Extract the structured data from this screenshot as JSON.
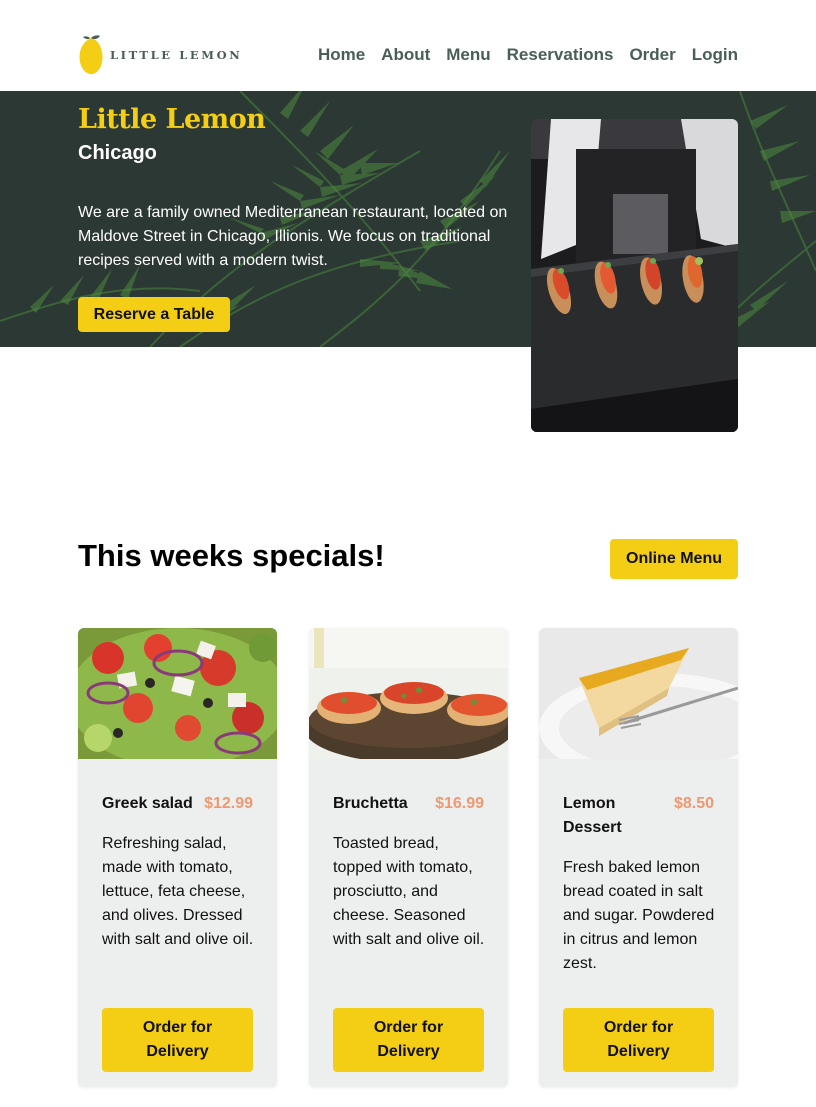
{
  "brand": {
    "logo_text": "LITTLE LEMON",
    "logo_icon": "lemon-icon",
    "colors": {
      "primary_green": "#495e57",
      "primary_yellow": "#f4ce14",
      "accent_orange": "#ee9972",
      "card_bg": "#edefee"
    }
  },
  "nav": {
    "items": [
      {
        "label": "Home"
      },
      {
        "label": "About"
      },
      {
        "label": "Menu"
      },
      {
        "label": "Reservations"
      },
      {
        "label": "Order"
      },
      {
        "label": "Login"
      }
    ]
  },
  "hero": {
    "title": "Little Lemon",
    "subtitle": "Chicago",
    "description": "We are a family owned Mediterranean restaurant, located on Maldove Street in Chicago, Illionis. We focus on traditional recipes served with a modern twist.",
    "cta_label": "Reserve a Table"
  },
  "specials": {
    "title": "This weeks specials!",
    "menu_button_label": "Online Menu",
    "cards": [
      {
        "name": "Greek salad",
        "price": "$12.99",
        "description": "Refreshing salad, made with tomato, lettuce, feta cheese, and olives. Dressed with salt and olive oil.",
        "button_label": "Order for Delivery"
      },
      {
        "name": "Bruchetta",
        "price": "$16.99",
        "description": "Toasted bread, topped with tomato, prosciutto, and cheese. Seasoned with salt and olive oil.",
        "button_label": "Order for Delivery"
      },
      {
        "name": "Lemon Dessert",
        "price": "$8.50",
        "description": "Fresh baked lemon bread coated in salt and sugar. Powdered in citrus and lemon zest.",
        "button_label": "Order for Delivery"
      }
    ]
  }
}
